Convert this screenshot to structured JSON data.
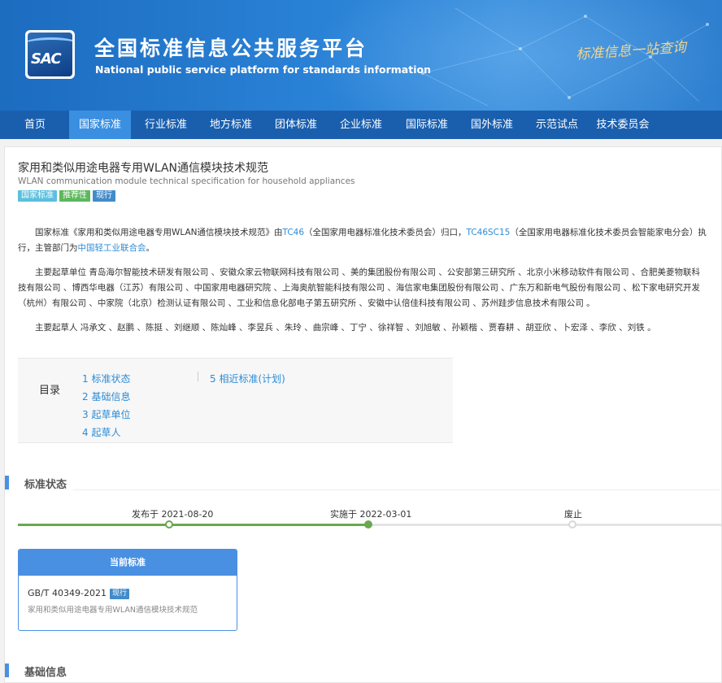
{
  "header": {
    "logo_text": "SAC",
    "title": "全国标准信息公共服务平台",
    "subtitle": "National public service platform  for standards information",
    "slogan": "标准信息一站查询"
  },
  "nav": {
    "items": [
      "首页",
      "国家标准",
      "行业标准",
      "地方标准",
      "团体标准",
      "企业标准",
      "国际标准",
      "国外标准",
      "示范试点",
      "技术委员会"
    ],
    "active_index": 1
  },
  "standard": {
    "title": "家用和类似用途电器专用WLAN通信模块技术规范",
    "title_en": "WLAN communication module technical specification for household appliances",
    "badges": [
      "国家标准",
      "推荐性",
      "现行"
    ]
  },
  "intro": {
    "p1_a": "国家标准《家用和类似用途电器专用WLAN通信模块技术规范》由",
    "tc_link": "TC46",
    "p1_b": "（全国家用电器标准化技术委员会）归口，",
    "sc_link": "TC46SC15",
    "p1_c": "（全国家用电器标准化技术委员会智能家电分会）执行，主管部门为",
    "dept_link": "中国轻工业联合会",
    "p1_d": "。",
    "drafting_units": "主要起草单位 青岛海尔智能技术研发有限公司 、安徽众家云物联网科技有限公司 、美的集团股份有限公司 、公安部第三研究所 、北京小米移动软件有限公司 、合肥美菱物联科技有限公司 、博西华电器（江苏）有限公司 、中国家用电器研究院 、上海奥航智能科技有限公司 、海信家电集团股份有限公司 、广东万和新电气股份有限公司 、松下家电研究开发（杭州）有限公司 、中家院（北京）检测认证有限公司 、工业和信息化部电子第五研究所 、安徽中认倍佳科技有限公司 、苏州跬步信息技术有限公司 。",
    "drafters": "主要起草人 冯承文 、赵鹏 、陈挺 、刘继顺 、陈灿峰 、李昱兵 、朱玲 、曲宗峰 、丁宁 、徐祥智 、刘旭敏 、孙颖楷 、贾春耕 、胡亚欣 、卜宏泽 、李欣 、刘铁 。"
  },
  "toc": {
    "label": "目录",
    "col1": [
      "1  标准状态",
      "2  基础信息",
      "3  起草单位",
      "4  起草人"
    ],
    "col2": [
      "5  相近标准(计划)"
    ]
  },
  "status_section": {
    "title": "标准状态",
    "timeline": [
      {
        "label": "发布于 2021-08-20",
        "state": "done"
      },
      {
        "label": "实施于 2022-03-01",
        "state": "current"
      },
      {
        "label": "废止",
        "state": "pending"
      }
    ],
    "current_box": {
      "header": "当前标准",
      "code": "GB/T 40349-2021",
      "badge": "现行",
      "name": "家用和类似用途电器专用WLAN通信模块技术规范"
    }
  },
  "basic_section": {
    "title": "基础信息"
  },
  "colors": {
    "nav_bg": "#1a5fae",
    "nav_active": "#3a8fe0",
    "link": "#2d8cd6",
    "accent": "#4a90e2",
    "timeline_done": "#6aa84f"
  }
}
